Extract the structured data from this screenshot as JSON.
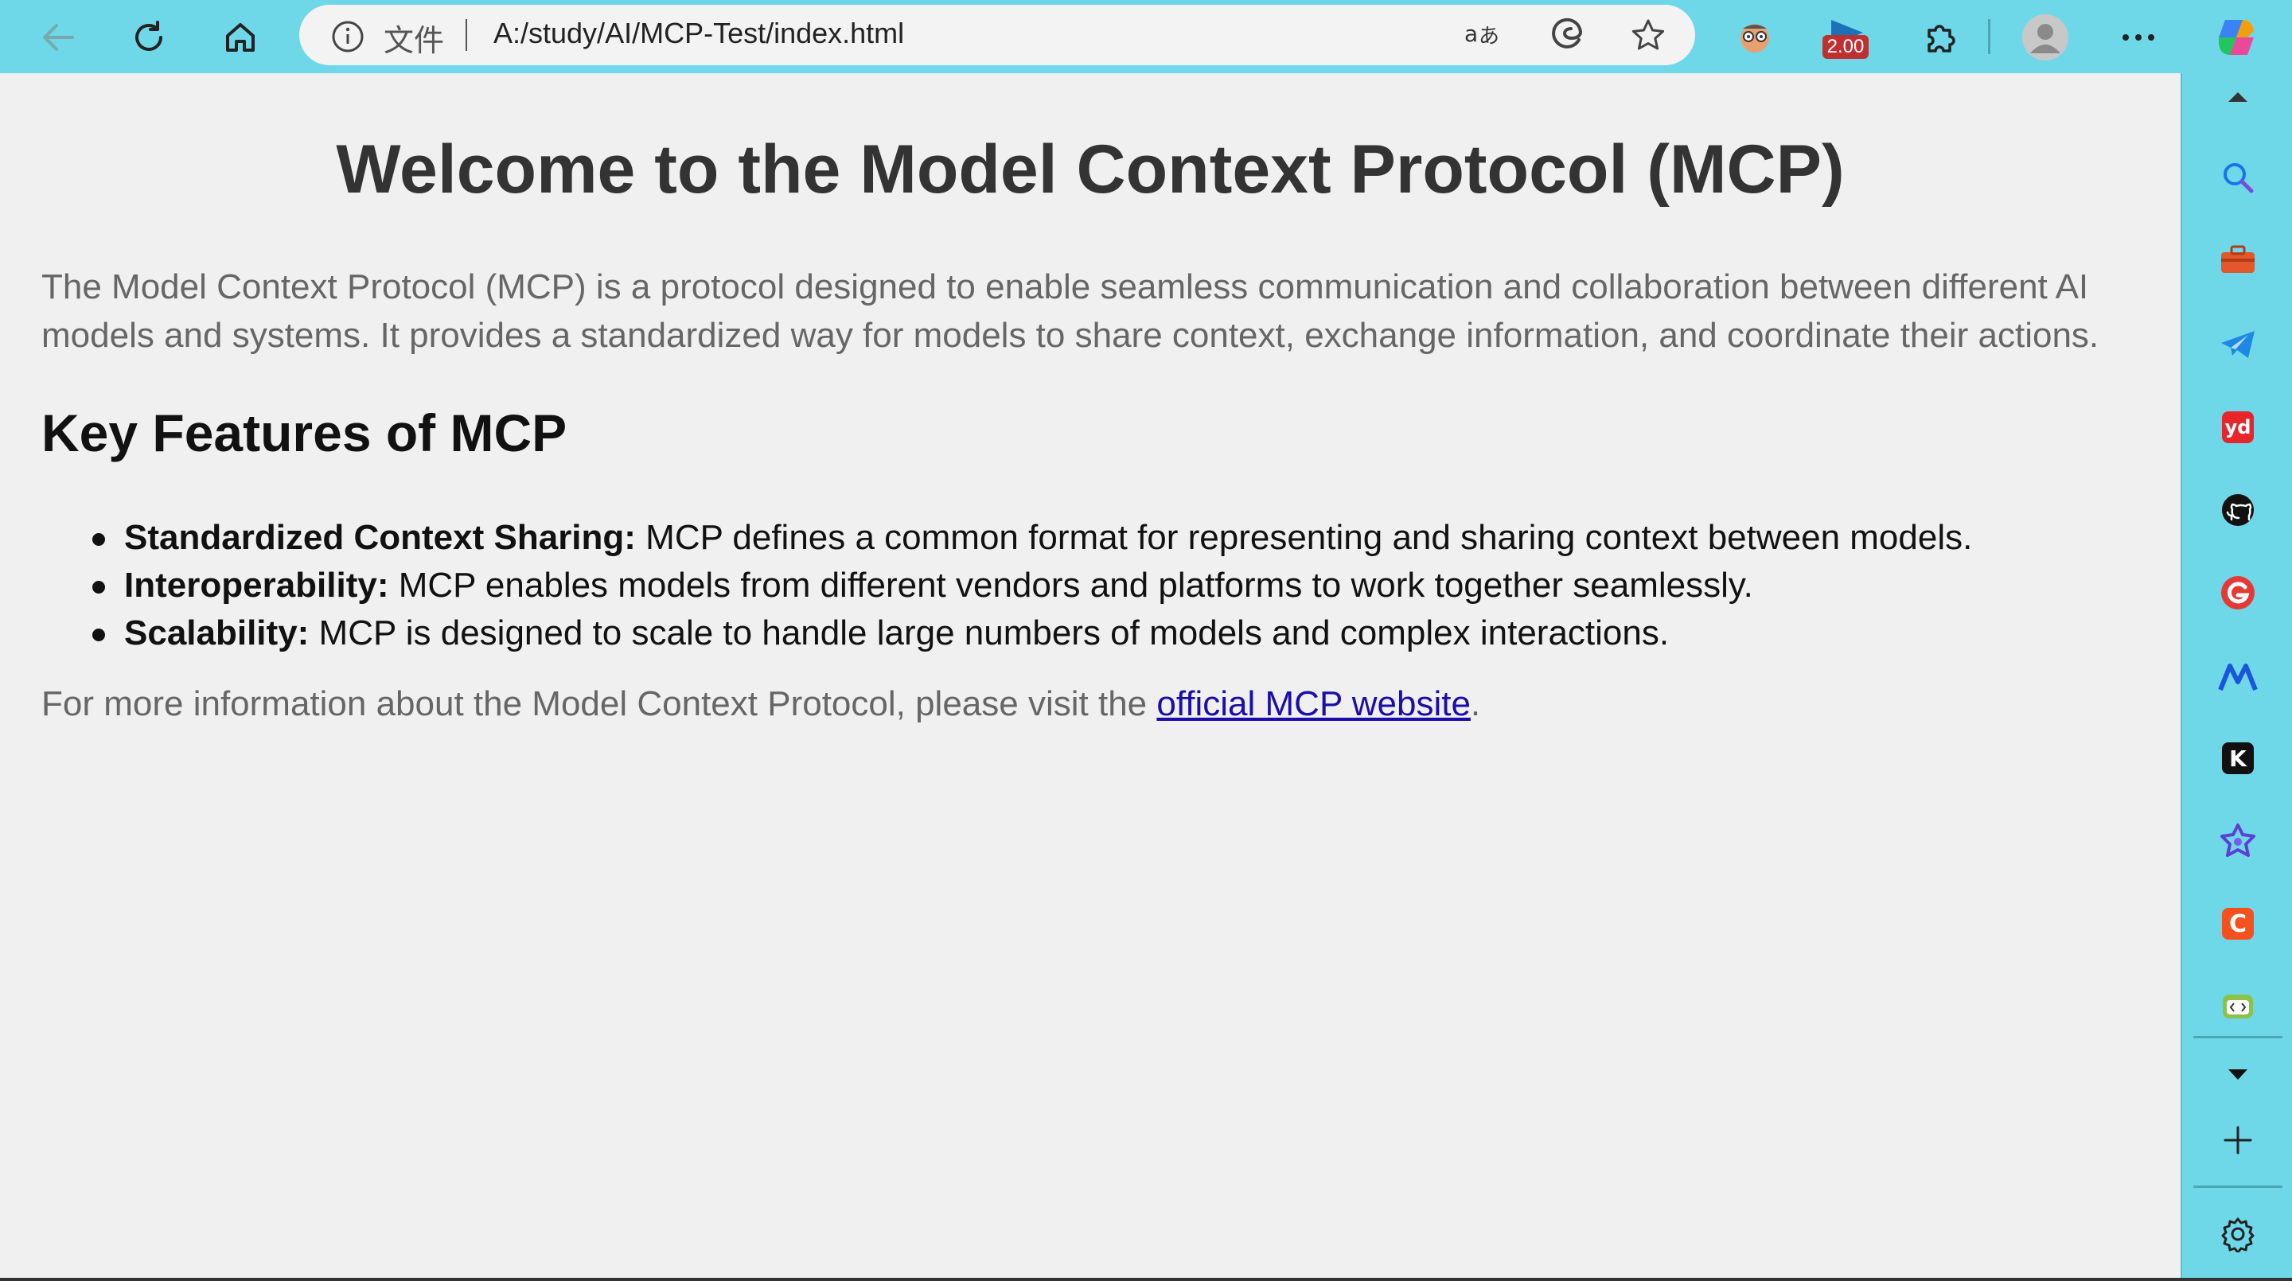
{
  "browser": {
    "address_bar": {
      "scheme_label": "文件",
      "url": "A:/study/AI/MCP-Test/index.html"
    },
    "extension_badge": "2.00",
    "icons": {
      "back": "back-arrow-icon",
      "reload": "reload-icon",
      "home": "home-icon",
      "info": "info-icon",
      "read_aloud": "translate-icon",
      "edge": "edge-icon",
      "favorite": "star-icon",
      "extensions": "puzzle-icon",
      "profile": "avatar-icon",
      "more": "more-icon",
      "copilot": "copilot-icon"
    },
    "colors": {
      "chrome": "#6fd8e8",
      "link": "#1a0dab"
    }
  },
  "page": {
    "title": "Welcome to the Model Context Protocol (MCP)",
    "intro": "The Model Context Protocol (MCP) is a protocol designed to enable seamless communication and collaboration between different AI models and systems. It provides a standardized way for models to share context, exchange information, and coordinate their actions.",
    "features_heading": "Key Features of MCP",
    "features": [
      {
        "name": "Standardized Context Sharing:",
        "desc": " MCP defines a common format for representing and sharing context between models."
      },
      {
        "name": "Interoperability:",
        "desc": " MCP enables models from different vendors and platforms to work together seamlessly."
      },
      {
        "name": "Scalability:",
        "desc": " MCP is designed to scale to handle large numbers of models and complex interactions."
      }
    ],
    "more_prefix": "For more information about the Model Context Protocol, please visit the ",
    "more_link": "official MCP website",
    "more_suffix": "."
  },
  "sidebar": {
    "items": [
      {
        "name": "scroll-up-icon"
      },
      {
        "name": "search-icon"
      },
      {
        "name": "toolbox-icon"
      },
      {
        "name": "telegram-icon"
      },
      {
        "name": "youdao-icon",
        "text": "yd"
      },
      {
        "name": "github-icon"
      },
      {
        "name": "g-logo-icon"
      },
      {
        "name": "m-logo-icon"
      },
      {
        "name": "k-logo-icon",
        "text": "K"
      },
      {
        "name": "perplexity-icon"
      },
      {
        "name": "c-logo-icon",
        "text": "C"
      },
      {
        "name": "code-tool-icon"
      },
      {
        "name": "scroll-down-icon"
      },
      {
        "name": "add-icon"
      },
      {
        "name": "settings-icon"
      }
    ]
  }
}
